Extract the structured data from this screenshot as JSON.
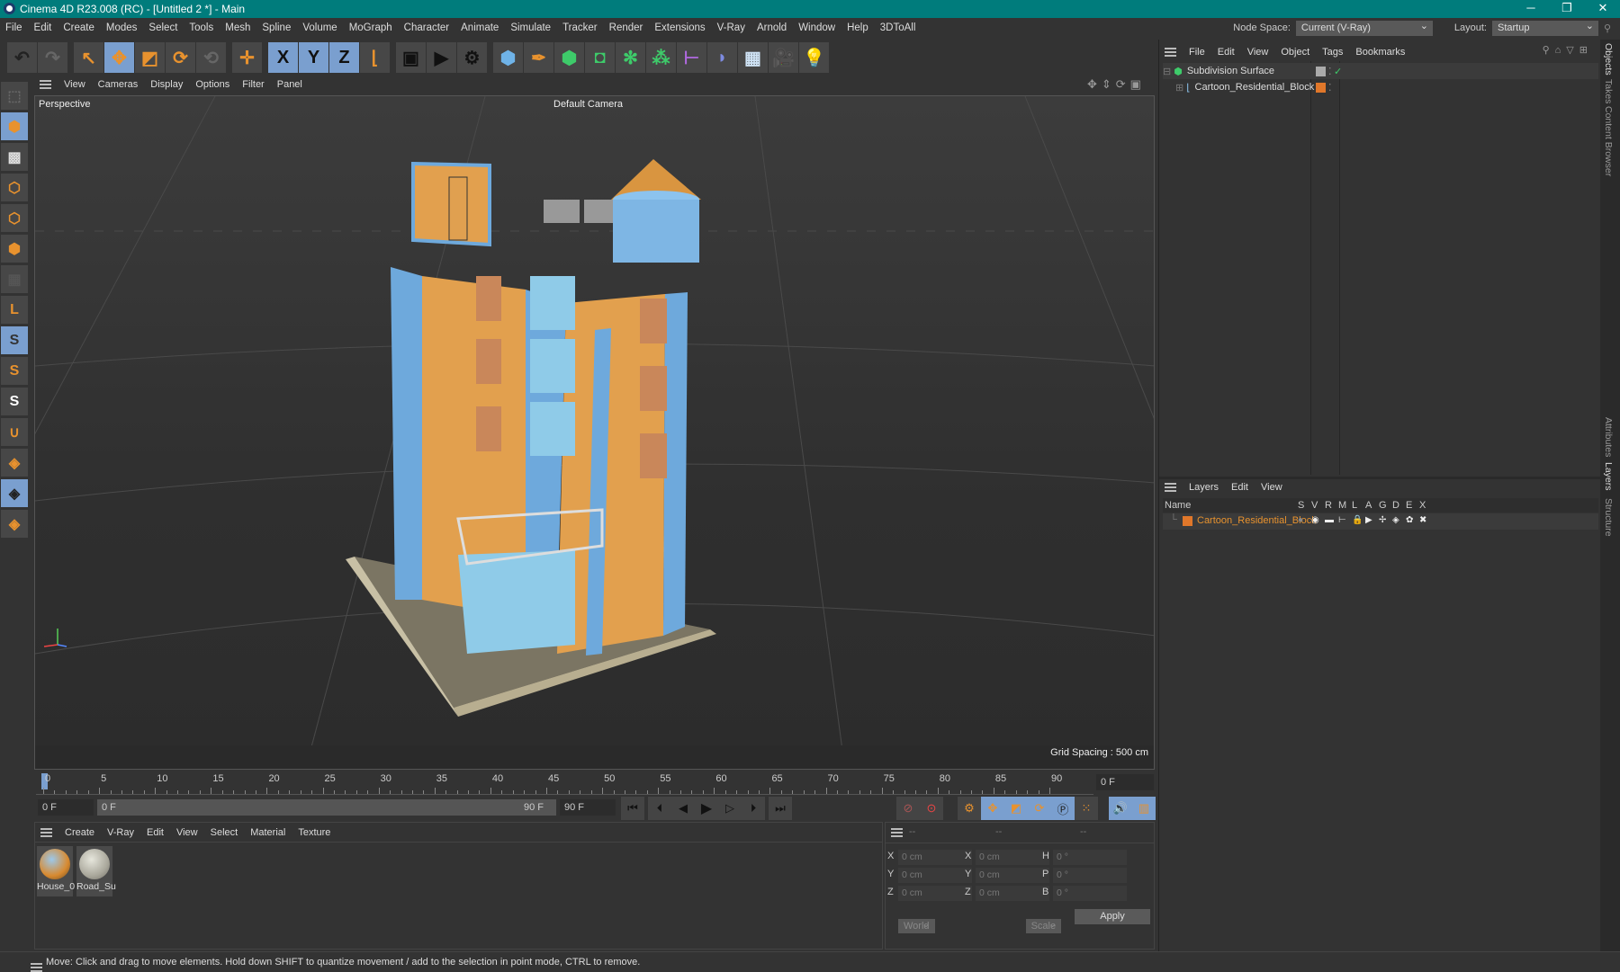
{
  "title": "Cinema 4D R23.008 (RC) - [Untitled 2 *] - Main",
  "menu": [
    "File",
    "Edit",
    "Create",
    "Modes",
    "Select",
    "Tools",
    "Mesh",
    "Spline",
    "Volume",
    "MoGraph",
    "Character",
    "Animate",
    "Simulate",
    "Tracker",
    "Render",
    "Extensions",
    "V-Ray",
    "Arnold",
    "Window",
    "Help",
    "3DToAll"
  ],
  "node_space": {
    "label": "Node Space:",
    "value": "Current (V-Ray)"
  },
  "layout": {
    "label": "Layout:",
    "value": "Startup"
  },
  "toolbar": [
    {
      "n": "undo-icon",
      "g": "↶",
      "c": "#222"
    },
    {
      "n": "redo-icon",
      "g": "↷",
      "c": "#666"
    },
    {
      "n": "gap"
    },
    {
      "n": "select-icon",
      "g": "↖",
      "c": "#e8922e"
    },
    {
      "n": "move-icon",
      "g": "✥",
      "c": "#e8922e",
      "on": true
    },
    {
      "n": "scale-icon",
      "g": "◩",
      "c": "#e8922e"
    },
    {
      "n": "rotate-icon",
      "g": "⟳",
      "c": "#e8922e"
    },
    {
      "n": "psr-icon",
      "g": "⟲",
      "c": "#666"
    },
    {
      "n": "gap"
    },
    {
      "n": "world-axis-icon",
      "g": "✛",
      "c": "#e8922e"
    },
    {
      "n": "gap"
    },
    {
      "n": "x-axis-icon",
      "g": "X",
      "c": "#111",
      "on": true
    },
    {
      "n": "y-axis-icon",
      "g": "Y",
      "c": "#111",
      "on": true
    },
    {
      "n": "z-axis-icon",
      "g": "Z",
      "c": "#111",
      "on": true
    },
    {
      "n": "coordinate-system-icon",
      "g": "⌊",
      "c": "#e8922e"
    },
    {
      "n": "gap"
    },
    {
      "n": "render-view-icon",
      "g": "▣",
      "c": "#111"
    },
    {
      "n": "render-picture-viewer-icon",
      "g": "▶",
      "c": "#111"
    },
    {
      "n": "render-settings-icon",
      "g": "⚙",
      "c": "#111"
    },
    {
      "n": "gap"
    },
    {
      "n": "cube-icon",
      "g": "⬢",
      "c": "#6fb3e8"
    },
    {
      "n": "pen-icon",
      "g": "✒",
      "c": "#e8922e"
    },
    {
      "n": "subdivision-icon",
      "g": "⬢",
      "c": "#3ecb6a"
    },
    {
      "n": "extrude-icon",
      "g": "◘",
      "c": "#3ecb6a"
    },
    {
      "n": "cloner-icon",
      "g": "✻",
      "c": "#3ecb6a"
    },
    {
      "n": "mograph-icon",
      "g": "⁂",
      "c": "#3ecb6a"
    },
    {
      "n": "deformer-icon",
      "g": "⊢",
      "c": "#b069e0"
    },
    {
      "n": "field-icon",
      "g": "◗",
      "c": "#7d8be0"
    },
    {
      "n": "floor-icon",
      "g": "▦",
      "c": "#cfe3f5"
    },
    {
      "n": "camera-icon",
      "g": "🎥",
      "c": "#ddd"
    },
    {
      "n": "light-icon",
      "g": "💡",
      "c": "#ddd"
    }
  ],
  "left_tools": [
    {
      "n": "make-editable-icon",
      "g": "⬚",
      "c": "#666"
    },
    {
      "n": "model-mode-icon",
      "g": "⬢",
      "c": "#e8922e",
      "on": true
    },
    {
      "n": "texture-mode-icon",
      "g": "▩",
      "c": "#ddd"
    },
    {
      "n": "point-mode-icon",
      "g": "⬡",
      "c": "#e8922e"
    },
    {
      "n": "edge-mode-icon",
      "g": "⬡",
      "c": "#e8922e"
    },
    {
      "n": "polygon-mode-icon",
      "g": "⬢",
      "c": "#e8922e"
    },
    {
      "n": "uv-mode-icon",
      "g": "▦",
      "c": "#555"
    },
    {
      "n": "axis-icon",
      "g": "L",
      "c": "#e8922e"
    },
    {
      "n": "snap-icon",
      "g": "S",
      "c": "#333",
      "on": true
    },
    {
      "n": "snap-settings-icon",
      "g": "S",
      "c": "#e8922e"
    },
    {
      "n": "quantize-icon",
      "g": "S",
      "c": "#fff"
    },
    {
      "n": "magnet-icon",
      "g": "∪",
      "c": "#e8922e"
    },
    {
      "n": "workplane-icon",
      "g": "◈",
      "c": "#e8922e"
    },
    {
      "n": "locked-workplane-icon",
      "g": "◈",
      "c": "#222",
      "on": true
    },
    {
      "n": "workplane-align-icon",
      "g": "◈",
      "c": "#e8922e"
    }
  ],
  "viewport": {
    "menu": [
      "View",
      "Cameras",
      "Display",
      "Options",
      "Filter",
      "Panel"
    ],
    "label": "Perspective",
    "camera": "Default Camera",
    "grid_spacing": "Grid Spacing : 500 cm"
  },
  "timeline": {
    "ticks": [
      "0",
      "5",
      "10",
      "15",
      "20",
      "25",
      "30",
      "35",
      "40",
      "45",
      "50",
      "55",
      "60",
      "65",
      "70",
      "75",
      "80",
      "85",
      "90"
    ],
    "current_frame": "0 F",
    "start": "0 F",
    "range_start": "0 F",
    "range_end": "90 F",
    "end": "90 F"
  },
  "materials": {
    "menu": [
      "Create",
      "V-Ray",
      "Edit",
      "View",
      "Select",
      "Material",
      "Texture"
    ],
    "items": [
      "House_0",
      "Road_Su"
    ]
  },
  "coords": {
    "headers": [
      "--",
      "--",
      "--"
    ],
    "rows": [
      {
        "a": "X",
        "v1": "0 cm",
        "b": "X",
        "v2": "0 cm",
        "c": "H",
        "v3": "0 °"
      },
      {
        "a": "Y",
        "v1": "0 cm",
        "b": "Y",
        "v2": "0 cm",
        "c": "P",
        "v3": "0 °"
      },
      {
        "a": "Z",
        "v1": "0 cm",
        "b": "Z",
        "v2": "0 cm",
        "c": "B",
        "v3": "0 °"
      }
    ],
    "mode": "World",
    "type": "Scale",
    "apply": "Apply"
  },
  "objects": {
    "menu": [
      "File",
      "Edit",
      "View",
      "Object",
      "Tags",
      "Bookmarks"
    ],
    "items": [
      {
        "name": "Subdivision Surface"
      },
      {
        "name": "Cartoon_Residential_Block"
      }
    ]
  },
  "layers": {
    "menu": [
      "Layers",
      "Edit",
      "View"
    ],
    "name_header": "Name",
    "columns": [
      "S",
      "V",
      "R",
      "M",
      "L",
      "A",
      "G",
      "D",
      "E",
      "X"
    ],
    "items": [
      {
        "name": "Cartoon_Residential_Block",
        "color": "#e0772a"
      }
    ]
  },
  "side_tabs": [
    "Objects",
    "Takes",
    "Content Browser",
    "Attributes",
    "Layers",
    "Structure"
  ],
  "status": "Move: Click and drag to move elements. Hold down SHIFT to quantize movement / add to the selection in point mode, CTRL to remove."
}
